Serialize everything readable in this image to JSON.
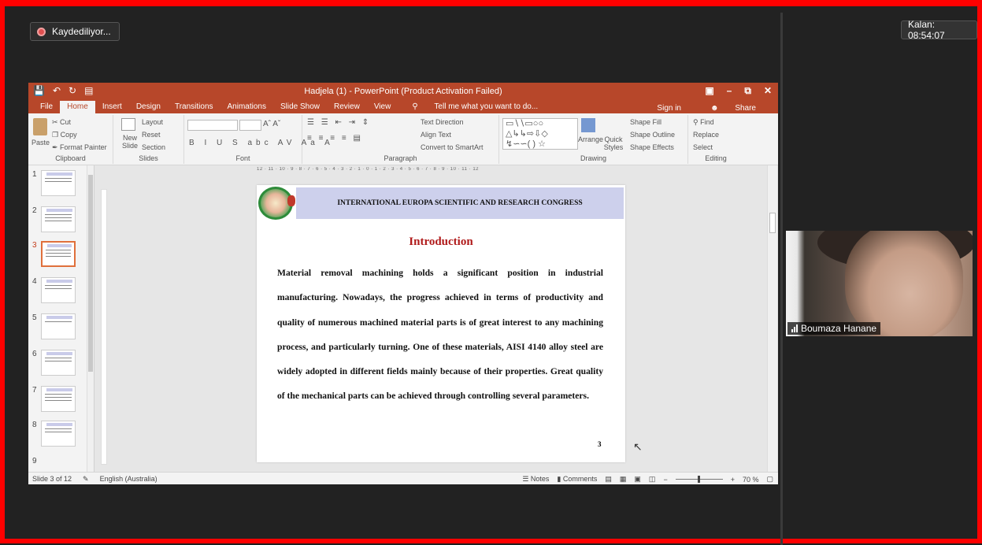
{
  "recording": {
    "label": "Kaydediliyor..."
  },
  "timer": {
    "label": "Kalan: 08:54:07"
  },
  "participant": {
    "name": "Boumaza Hanane"
  },
  "ppt": {
    "title": "Hadjela (1) - PowerPoint (Product Activation Failed)",
    "tabs": [
      "File",
      "Home",
      "Insert",
      "Design",
      "Transitions",
      "Animations",
      "Slide Show",
      "Review",
      "View",
      "Tell me what you want to do..."
    ],
    "signin": "Sign in",
    "share": "Share",
    "ribbon": {
      "clipboard": {
        "paste": "Paste",
        "cut": "Cut",
        "copy": "Copy",
        "format_painter": "Format Painter",
        "label": "Clipboard"
      },
      "slides": {
        "new_slide": "New Slide",
        "layout": "Layout",
        "reset": "Reset",
        "section": "Section",
        "label": "Slides"
      },
      "font": {
        "label": "Font"
      },
      "paragraph": {
        "text_direction": "Text Direction",
        "align_text": "Align Text",
        "convert": "Convert to SmartArt",
        "label": "Paragraph"
      },
      "drawing": {
        "arrange": "Arrange",
        "quick_styles": "Quick Styles",
        "shape_fill": "Shape Fill",
        "shape_outline": "Shape Outline",
        "shape_effects": "Shape Effects",
        "label": "Drawing"
      },
      "editing": {
        "find": "Find",
        "replace": "Replace",
        "select": "Select",
        "label": "Editing"
      }
    },
    "ruler_text": "12 · 11 · 10 · 9 · 8 · 7 · 6 · 5 · 4 · 3 · 2 · 1 · 0 · 1 · 2 · 3 · 4 · 5 · 6 · 7 · 8 · 9 · 10 · 11 · 12",
    "thumb_numbers": [
      "1",
      "2",
      "3",
      "4",
      "5",
      "6",
      "7",
      "8",
      "9"
    ],
    "slide": {
      "header": "INTERNATIONAL EUROPA SCIENTIFIC AND RESEARCH CONGRESS",
      "heading": "Introduction",
      "body": "Material removal machining holds a significant position in industrial manufacturing. Nowadays, the progress achieved in terms of productivity and quality of numerous machined material parts is of great interest to any machining process, and particularly turning. One of these materials, AISI 4140 alloy steel are widely adopted in different fields mainly because of their properties. Great quality of the mechanical parts can be achieved through controlling several parameters.",
      "page_number": "3"
    },
    "status": {
      "slide_info": "Slide 3 of 12",
      "language": "English (Australia)",
      "notes": "Notes",
      "comments": "Comments",
      "zoom": "70 %"
    }
  },
  "colors": {
    "ppt_accent": "#b7472a",
    "frame": "#ff0000",
    "slide_band": "#cdd0ec",
    "heading": "#b01b1b"
  }
}
